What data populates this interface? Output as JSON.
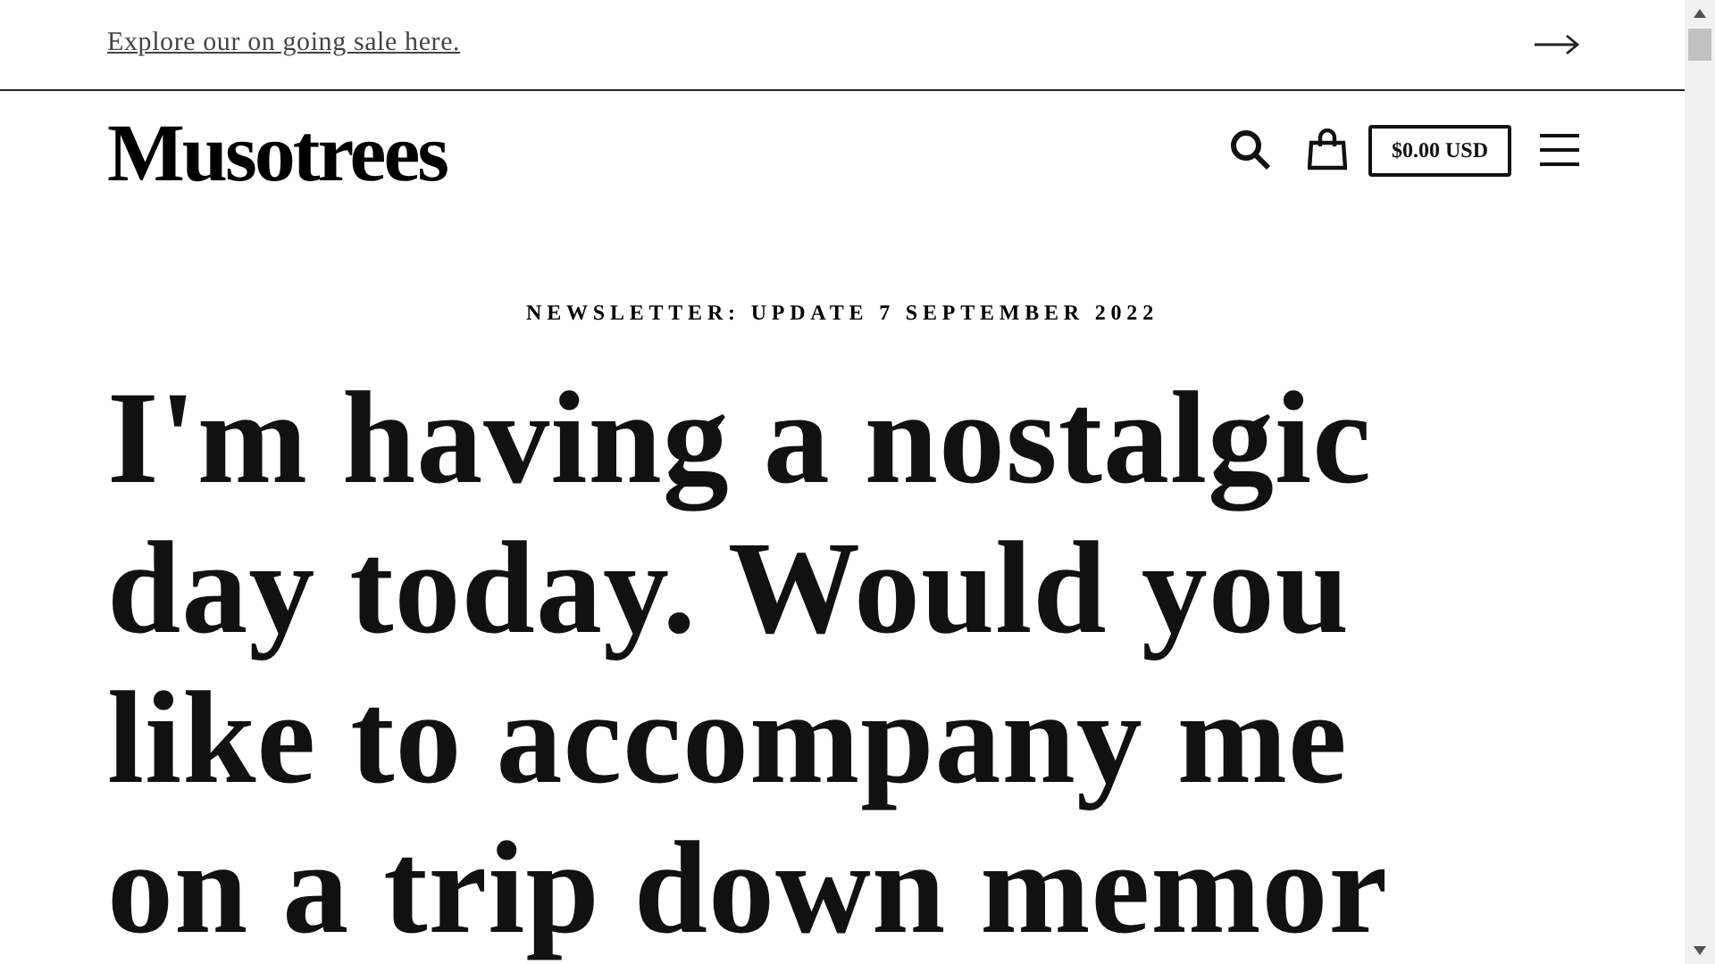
{
  "announcement": {
    "text": "Explore our on going sale here."
  },
  "header": {
    "logo": "Musotrees",
    "cart_total": "$0.00 USD"
  },
  "article": {
    "eyebrow": "NEWSLETTER: UPDATE 7 SEPTEMBER 2022",
    "title": "I'm having a nostalgic day today. Would you like to accompany me on a trip down memor"
  }
}
